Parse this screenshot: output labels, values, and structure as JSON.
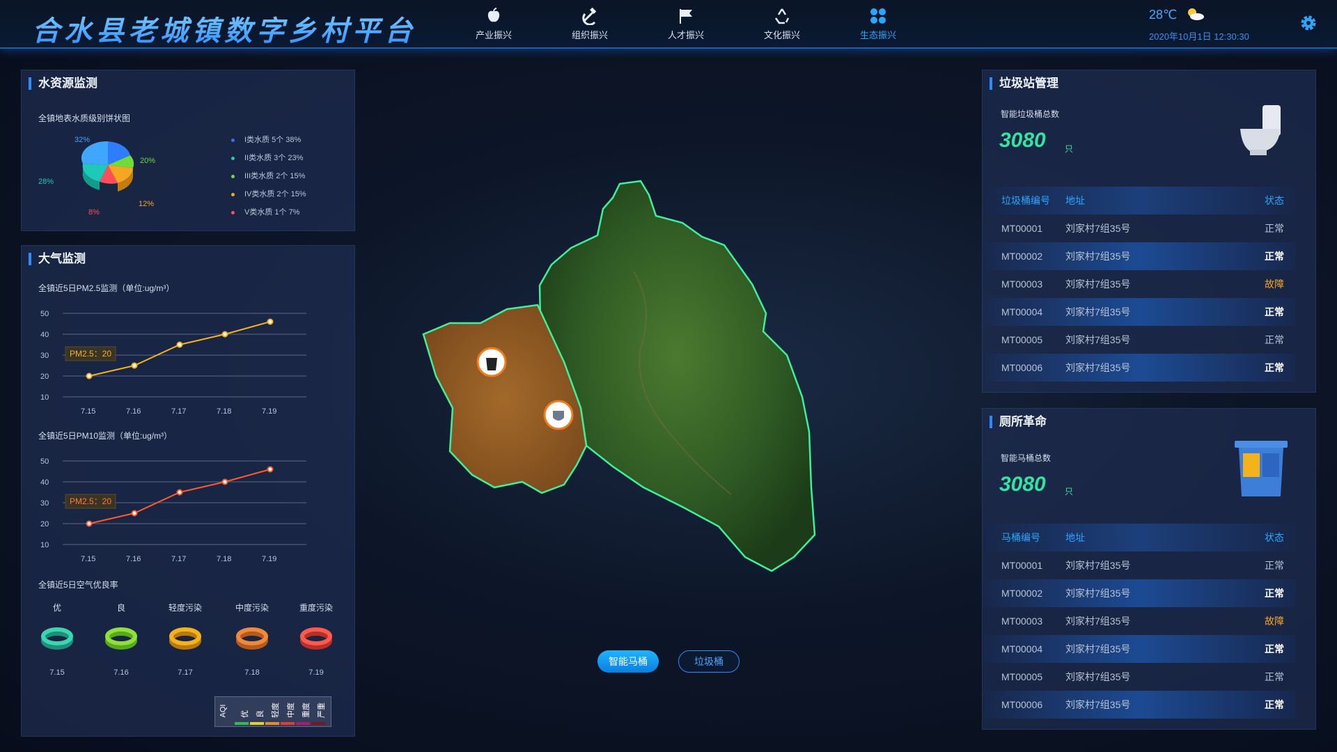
{
  "app_title": "合水县老城镇数字乡村平台",
  "nav": [
    {
      "label": "产业振兴",
      "icon": "apple-icon"
    },
    {
      "label": "组织振兴",
      "icon": "hammer-sickle-icon"
    },
    {
      "label": "人才振兴",
      "icon": "flag-icon"
    },
    {
      "label": "文化振兴",
      "icon": "recycle-icon"
    },
    {
      "label": "生态振兴",
      "icon": "grid-dots-icon",
      "active": true
    }
  ],
  "weather": {
    "temp": "28℃",
    "icon": "partly-cloudy-icon",
    "datetime": "2020年10月1日   12:30:30"
  },
  "water": {
    "title": "水资源监测",
    "subtitle": "全镇地表水质级别饼状图",
    "pcts": [
      "32%",
      "20%",
      "28%",
      "12%",
      "8%"
    ],
    "legend": [
      {
        "text": "I类水质 5个  38%",
        "color": "#3b6bff"
      },
      {
        "text": "II类水质 3个  23%",
        "color": "#1fd1a0"
      },
      {
        "text": "III类水质 2个 15%",
        "color": "#6fdc3a"
      },
      {
        "text": "IV类水质 2个 15%",
        "color": "#f5a623"
      },
      {
        "text": "V类水质 1个   7%",
        "color": "#ff4d5a"
      }
    ]
  },
  "air": {
    "title": "大气监测",
    "pm25_title": "全镇近5日PM2.5监测（单位:ug/m³）",
    "pm10_title": "全镇近5日PM10监测（单位:ug/m³）",
    "tooltip": "PM2.5：20",
    "aqi_title": "全镇近5日空气优良率",
    "aqi_levels": [
      "优",
      "良",
      "轻度污染",
      "中度污染",
      "重度污染"
    ],
    "aqi_dates": [
      "7.15",
      "7.16",
      "7.17",
      "7.18",
      "7.19"
    ],
    "aqi_legend_title": "AQI",
    "aqi_legend_items": [
      "优",
      "良",
      "轻度",
      "中度",
      "重度",
      "严重"
    ]
  },
  "chart_data": [
    {
      "type": "line",
      "title": "全镇近5日PM2.5监测（单位:ug/m³）",
      "x": [
        "7.15",
        "7.16",
        "7.17",
        "7.18",
        "7.19"
      ],
      "ylim": [
        10,
        50
      ],
      "yticks": [
        10,
        20,
        30,
        40,
        50
      ],
      "series": [
        {
          "values": [
            20,
            25,
            35,
            40,
            46
          ]
        }
      ],
      "color": "#f5b21b"
    },
    {
      "type": "line",
      "title": "全镇近5日PM10监测（单位:ug/m³）",
      "x": [
        "7.15",
        "7.16",
        "7.17",
        "7.18",
        "7.19"
      ],
      "ylim": [
        10,
        50
      ],
      "yticks": [
        10,
        20,
        30,
        40,
        50
      ],
      "series": [
        {
          "values": [
            20,
            25,
            35,
            40,
            46
          ]
        }
      ],
      "color": "#ff5a2a"
    }
  ],
  "garbage": {
    "title": "垃圾站管理",
    "total_label": "智能垃圾桶总数",
    "total": "3080",
    "unit": "只",
    "headers": [
      "垃圾桶编号",
      "地址",
      "状态"
    ],
    "rows": [
      {
        "id": "MT00001",
        "addr": "刘家村7组35号",
        "status": "正常"
      },
      {
        "id": "MT00002",
        "addr": "刘家村7组35号",
        "status": "正常"
      },
      {
        "id": "MT00003",
        "addr": "刘家村7组35号",
        "status": "故障"
      },
      {
        "id": "MT00004",
        "addr": "刘家村7组35号",
        "status": "正常"
      },
      {
        "id": "MT00005",
        "addr": "刘家村7组35号",
        "status": "正常"
      },
      {
        "id": "MT00006",
        "addr": "刘家村7组35号",
        "status": "正常"
      }
    ]
  },
  "toilet": {
    "title": "厕所革命",
    "total_label": "智能马桶总数",
    "total": "3080",
    "unit": "只",
    "headers": [
      "马桶编号",
      "地址",
      "状态"
    ],
    "rows": [
      {
        "id": "MT00001",
        "addr": "刘家村7组35号",
        "status": "正常"
      },
      {
        "id": "MT00002",
        "addr": "刘家村7组35号",
        "status": "正常"
      },
      {
        "id": "MT00003",
        "addr": "刘家村7组35号",
        "status": "故障"
      },
      {
        "id": "MT00004",
        "addr": "刘家村7组35号",
        "status": "正常"
      },
      {
        "id": "MT00005",
        "addr": "刘家村7组35号",
        "status": "正常"
      },
      {
        "id": "MT00006",
        "addr": "刘家村7组35号",
        "status": "正常"
      }
    ]
  },
  "map_buttons": {
    "toilet": "智能马桶",
    "garbage": "垃圾桶"
  }
}
